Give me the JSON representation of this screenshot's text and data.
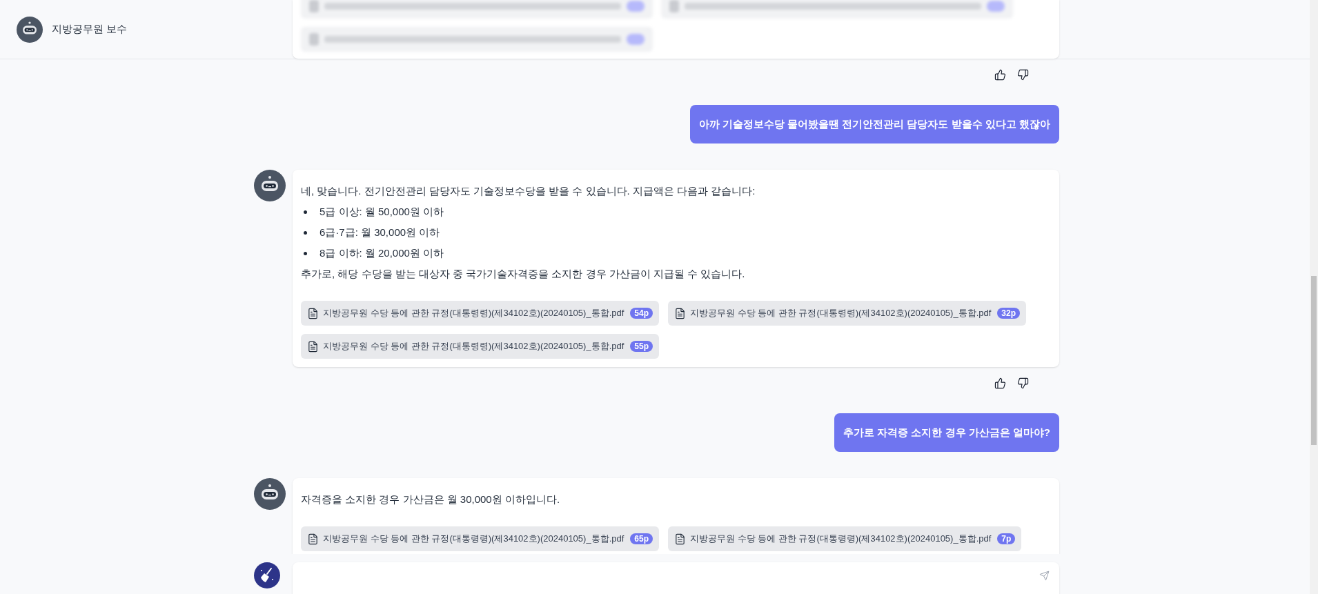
{
  "header": {
    "title": "지방공무원 보수"
  },
  "messages": [
    {
      "kind": "assistant_cut",
      "feedback": true
    },
    {
      "kind": "user",
      "text": "아까 기술정보수당 물어봤을땐 전기안전관리 담당자도 받을수 있다고 했잖아"
    },
    {
      "kind": "assistant",
      "feedback": true,
      "blocks": [
        {
          "kind": "text",
          "text": "네, 맞습니다. 전기안전관리 담당자도 기술정보수당을 받을 수 있습니다. 지급액은 다음과 같습니다:"
        },
        {
          "kind": "bullet",
          "text": "5급 이상: 월 50,000원 이하"
        },
        {
          "kind": "bullet",
          "text": "6급·7급: 월 30,000원 이하"
        },
        {
          "kind": "bullet",
          "text": "8급 이하: 월 20,000원 이하"
        },
        {
          "kind": "text",
          "text": "추가로, 해당 수당을 받는 대상자 중 국가기술자격증을 소지한 경우 가산금이 지급될 수 있습니다."
        }
      ],
      "sources": [
        {
          "file": "지방공무원 수당 등에 관한 규정(대통령령)(제34102호)(20240105)_통합.pdf",
          "pages": "54p"
        },
        {
          "file": "지방공무원 수당 등에 관한 규정(대통령령)(제34102호)(20240105)_통합.pdf",
          "pages": "32p"
        },
        {
          "file": "지방공무원 수당 등에 관한 규정(대통령령)(제34102호)(20240105)_통합.pdf",
          "pages": "55p"
        }
      ]
    },
    {
      "kind": "user",
      "text": "추가로 자격증 소지한 경우 가산금은 얼마야?"
    },
    {
      "kind": "assistant",
      "feedback": false,
      "blocks": [
        {
          "kind": "text",
          "text": "자격증을 소지한 경우 가산금은 월 30,000원 이하입니다."
        }
      ],
      "sources": [
        {
          "file": "지방공무원 수당 등에 관한 규정(대통령령)(제34102호)(20240105)_통합.pdf",
          "pages": "65p"
        },
        {
          "file": "지방공무원 수당 등에 관한 규정(대통령령)(제34102호)(20240105)_통합.pdf",
          "pages": "7p"
        }
      ]
    }
  ]
}
